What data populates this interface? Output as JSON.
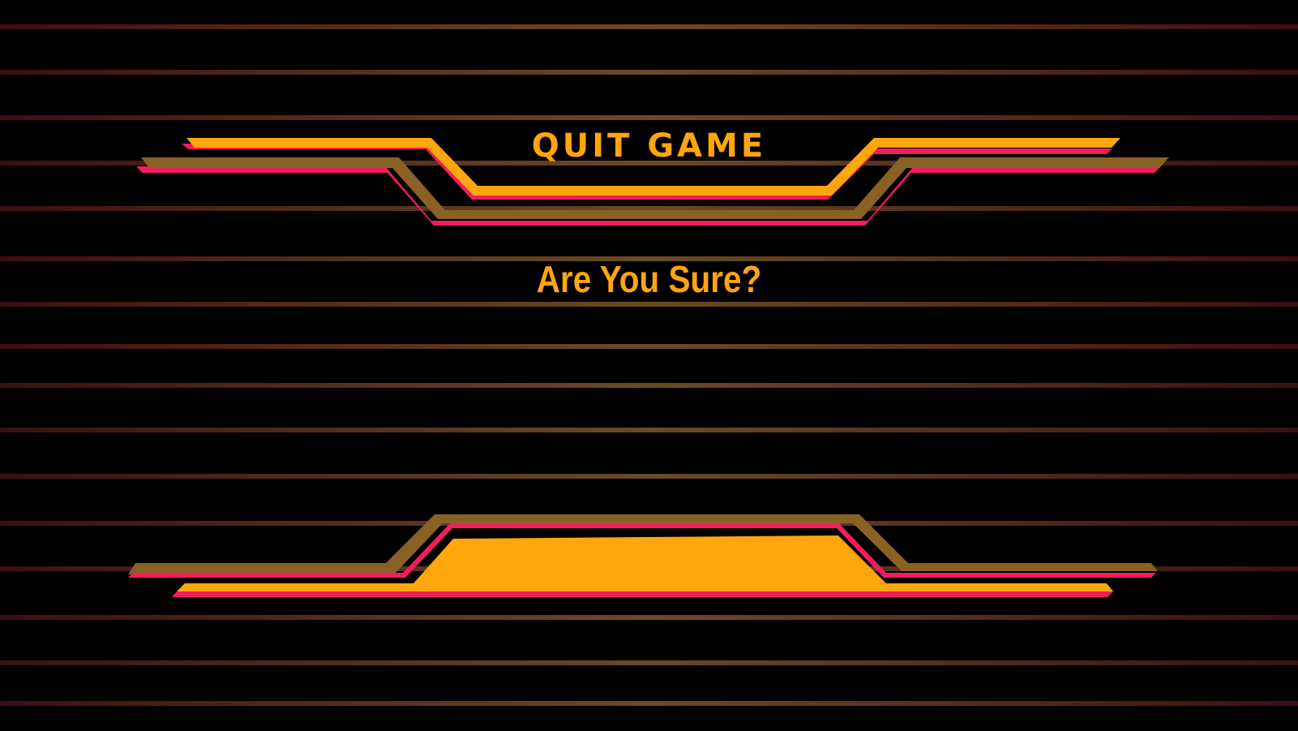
{
  "dialog": {
    "title": "QUIT GAME",
    "prompt": "Are You Sure?"
  },
  "colors": {
    "background": "#000000",
    "primary_orange": "#ffa60d",
    "accent_pink": "#f21d5d",
    "frame_olive": "#8a6124",
    "line_dark_red": "#3a0f13",
    "line_bronze": "#6b4a23"
  },
  "icons": {
    "top_frame": "chevron-frame-top",
    "bottom_frame": "chevron-frame-bottom"
  }
}
